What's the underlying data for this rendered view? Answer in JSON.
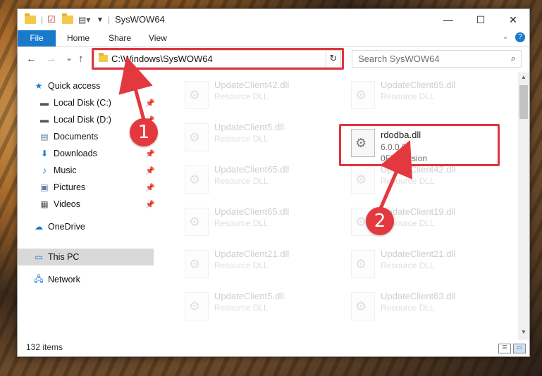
{
  "window": {
    "title": "SysWOW64",
    "minimize_symbol": "—",
    "maximize_symbol": "☐",
    "close_symbol": "✕"
  },
  "ribbon": {
    "tabs": [
      "File",
      "Home",
      "Share",
      "View"
    ]
  },
  "navigation": {
    "back_symbol": "←",
    "forward_symbol": "→",
    "recent_symbol": "⌄",
    "up_symbol": "↑",
    "address": "C:\\Windows\\SysWOW64",
    "refresh_symbol": "↻",
    "search_placeholder": "Search SysWOW64"
  },
  "sidebar": {
    "items": [
      {
        "label": "Quick access",
        "icon": "star-icon"
      },
      {
        "label": "Local Disk (C:)",
        "icon": "drive-icon",
        "pinned": true
      },
      {
        "label": "Local Disk (D:)",
        "icon": "drive-icon",
        "pinned": true
      },
      {
        "label": "Documents",
        "icon": "documents-icon",
        "pinned": true
      },
      {
        "label": "Downloads",
        "icon": "download-icon",
        "pinned": true
      },
      {
        "label": "Music",
        "icon": "music-icon",
        "pinned": true
      },
      {
        "label": "Pictures",
        "icon": "pictures-icon",
        "pinned": true
      },
      {
        "label": "Videos",
        "icon": "videos-icon",
        "pinned": true
      },
      {
        "label": "OneDrive",
        "icon": "cloud-icon"
      },
      {
        "label": "This PC",
        "icon": "computer-icon",
        "selected": true
      },
      {
        "label": "Network",
        "icon": "network-icon"
      }
    ]
  },
  "files": {
    "left_column": [
      {
        "name": "UpdateClient42.dll",
        "type": "Resource DLL"
      },
      {
        "name": "UpdateClient5.dll",
        "type": "Resource DLL"
      },
      {
        "name": "UpdateClient65.dll",
        "type": "Resource DLL"
      },
      {
        "name": "UpdateClient65.dll",
        "type": "Resource DLL"
      },
      {
        "name": "UpdateClient21.dll",
        "type": "Resource DLL"
      },
      {
        "name": "UpdateClient5.dll",
        "type": "Resource DLL"
      }
    ],
    "right_column": [
      {
        "name": "UpdateClient65.dll",
        "type": "Resource DLL"
      },
      {
        "name": "UpdateClient42.dll",
        "type": "Resource DLL"
      },
      {
        "name": "UpdateClient19.dll",
        "type": "Resource DLL"
      },
      {
        "name": "UpdateClient21.dll",
        "type": "Resource DLL"
      },
      {
        "name": "UpdateClient63.dll",
        "type": "Resource DLL"
      }
    ],
    "highlighted": {
      "name": "rdodba.dll",
      "version": "6.0.0.0",
      "description": "0FileVersion"
    }
  },
  "status": {
    "item_count": "132 items"
  },
  "callouts": [
    "1",
    "2"
  ],
  "colors": {
    "accent": "#1979ca",
    "highlight_red": "#e0353f"
  }
}
